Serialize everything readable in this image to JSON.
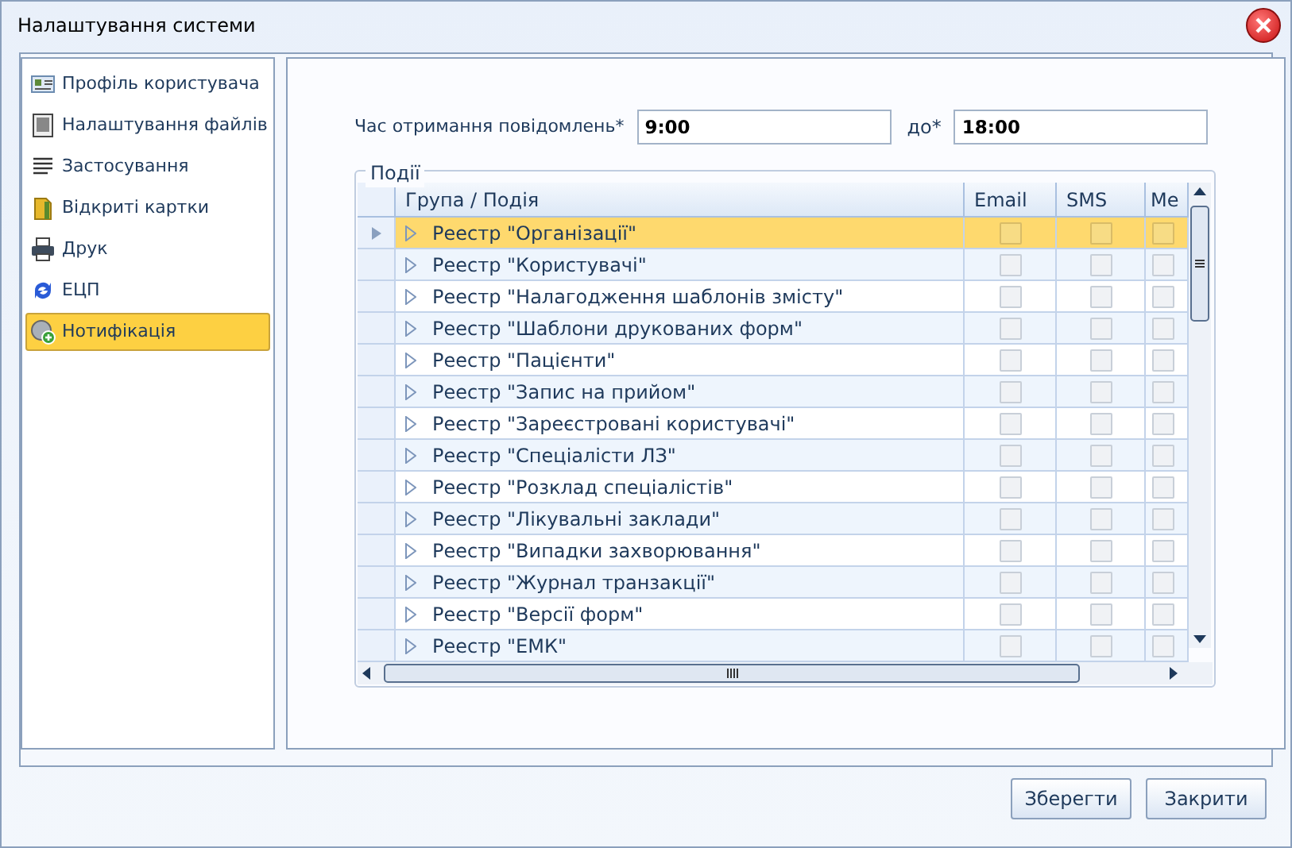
{
  "window": {
    "title": "Налаштування системи"
  },
  "sidebar": {
    "items": [
      {
        "label": "Профіль користувача",
        "selected": false
      },
      {
        "label": "Налаштування файлів",
        "selected": false
      },
      {
        "label": "Застосування",
        "selected": false
      },
      {
        "label": "Відкриті картки",
        "selected": false
      },
      {
        "label": "Друк",
        "selected": false
      },
      {
        "label": "ЕЦП",
        "selected": false
      },
      {
        "label": "Нотифікація",
        "selected": true
      }
    ]
  },
  "time": {
    "label": "Час отримання повідомлень*",
    "from": "9:00",
    "to_label": "до*",
    "to": "18:00"
  },
  "events": {
    "title": "Події",
    "columns": [
      "Група / Подія",
      "Email",
      "SMS",
      "Me"
    ],
    "rows": [
      {
        "name": "Реестр \"Організації\"",
        "selected": true
      },
      {
        "name": "Реестр \"Користувачі\"",
        "selected": false
      },
      {
        "name": "Реестр \"Налагодження шаблонів змісту\"",
        "selected": false
      },
      {
        "name": "Реестр \"Шаблони друкованих форм\"",
        "selected": false
      },
      {
        "name": "Реестр \"Пацієнти\"",
        "selected": false
      },
      {
        "name": "Реестр \"Запис на прийом\"",
        "selected": false
      },
      {
        "name": "Реестр \"Зареєстровані користувачі\"",
        "selected": false
      },
      {
        "name": "Реестр \"Спеціалісти ЛЗ\"",
        "selected": false
      },
      {
        "name": "Реестр \"Розклад спеціалістів\"",
        "selected": false
      },
      {
        "name": "Реестр \"Лікувальні заклади\"",
        "selected": false
      },
      {
        "name": "Реестр \"Випадки захворювання\"",
        "selected": false
      },
      {
        "name": "Реестр \"Журнал транзакції\"",
        "selected": false
      },
      {
        "name": "Реестр \"Версії форм\"",
        "selected": false
      },
      {
        "name": "Реестр \"ЕМК\"",
        "selected": false
      }
    ]
  },
  "buttons": [
    "Зберегти",
    "Закрити"
  ]
}
